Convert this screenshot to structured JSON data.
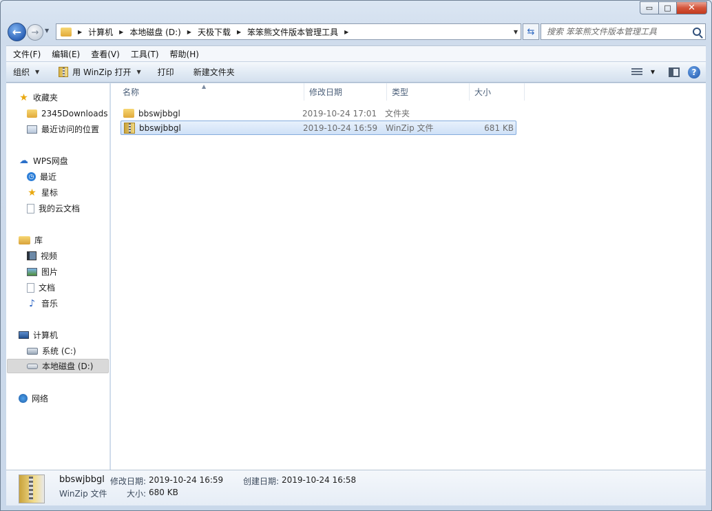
{
  "window": {
    "controls": {
      "minimize": "▭",
      "maximize": "□",
      "close": "✕"
    }
  },
  "address": {
    "breadcrumbs": [
      "计算机",
      "本地磁盘 (D:)",
      "天极下载",
      "笨笨熊文件版本管理工具"
    ],
    "search_placeholder": "搜索 笨笨熊文件版本管理工具"
  },
  "menubar": [
    "文件(F)",
    "编辑(E)",
    "查看(V)",
    "工具(T)",
    "帮助(H)"
  ],
  "toolbar": {
    "organize": "组织",
    "open_with": "用 WinZip 打开",
    "print": "打印",
    "new_folder": "新建文件夹"
  },
  "navpane": {
    "favorites": "收藏夹",
    "fav_items": [
      "2345Downloads",
      "最近访问的位置"
    ],
    "wps": "WPS网盘",
    "wps_items": [
      "最近",
      "星标",
      "我的云文档"
    ],
    "library": "库",
    "lib_items": [
      "视频",
      "图片",
      "文档",
      "音乐"
    ],
    "computer": "计算机",
    "computer_items": [
      "系统 (C:)",
      "本地磁盘 (D:)"
    ],
    "network": "网络"
  },
  "columns": {
    "name": "名称",
    "date": "修改日期",
    "type": "类型",
    "size": "大小"
  },
  "files": [
    {
      "name": "bbswjbbgl",
      "date": "2019-10-24 17:01",
      "type": "文件夹",
      "size": ""
    },
    {
      "name": "bbswjbbgl",
      "date": "2019-10-24 16:59",
      "type": "WinZip 文件",
      "size": "681 KB"
    }
  ],
  "details": {
    "name": "bbswjbbgl",
    "type": "WinZip 文件",
    "modified_label": "修改日期:",
    "modified": "2019-10-24 16:59",
    "created_label": "创建日期:",
    "created": "2019-10-24 16:58",
    "size_label": "大小:",
    "size": "680 KB"
  }
}
